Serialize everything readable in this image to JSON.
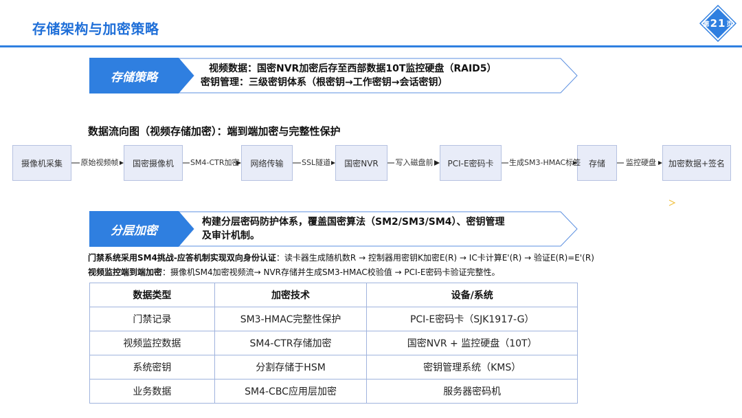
{
  "page": {
    "title": "存储架构与加密策略",
    "badge": {
      "prefix": "第",
      "number": "21",
      "suffix": "页"
    },
    "accent": "#1f6fd8"
  },
  "storage": {
    "label": "存储策略",
    "line1": "视频数据：国密NVR加密后存至西部数据10T监控硬盘（RAID5）",
    "line2": "密钥管理：三级密钥体系（根密钥→工作密钥→会话密钥）"
  },
  "flow": {
    "title": "数据流向图（视频存储加密）：端到端加密与完整性保护",
    "nodes": [
      "摄像机采集",
      "国密摄像机",
      "网络传输",
      "国密NVR",
      "PCI-E密码卡",
      "存储",
      "加密数据+签名"
    ],
    "edges": [
      "原始视频帧",
      "SM4-CTR加密",
      "SSL隧道",
      "写入磁盘前",
      "生成SM3-HMAC标签",
      "监控硬盘"
    ]
  },
  "layered": {
    "label": "分层加密",
    "line1": "构建分层密码防护体系，覆盖国密算法（SM2/SM3/SM4）、密钥管理",
    "line2": "及审计机制。"
  },
  "notes": {
    "n1_bold": "门禁系统采用SM4挑战-应答机制实现双向身份认证",
    "n1_text": "：读卡器生成随机数R → 控制器用密钥K加密E(R) → IC卡计算E'(R) → 验证E(R)=E'(R)",
    "n2_bold": "视频监控端到端加密",
    "n2_text": "：摄像机SM4加密视频流→ NVR存储并生成SM3-HMAC校验值 → PCI-E密码卡验证完整性。"
  },
  "table": {
    "headers": [
      "数据类型",
      "加密技术",
      "设备/系统"
    ],
    "rows": [
      [
        "门禁记录",
        "SM3-HMAC完整性保护",
        "PCI-E密码卡（SJK1917-G）"
      ],
      [
        "视频监控数据",
        "SM4-CTR存储加密",
        "国密NVR + 监控硬盘（10T）"
      ],
      [
        "系统密钥",
        "分割存储于HSM",
        "密钥管理系统（KMS）"
      ],
      [
        "业务数据",
        "SM4-CBC应用层加密",
        "服务器密码机"
      ]
    ]
  }
}
